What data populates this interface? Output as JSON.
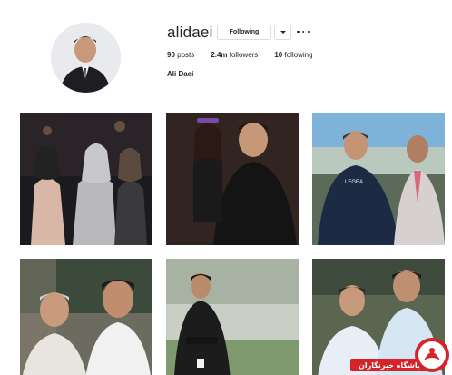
{
  "profile": {
    "username": "alidaei",
    "follow_label": "Following",
    "full_name": "Ali Daei",
    "stats": {
      "posts_count": "90",
      "posts_label": "posts",
      "followers_count": "2.4m",
      "followers_label": "followers",
      "following_count": "10",
      "following_label": "following"
    }
  },
  "icons": {
    "dropdown": "chevron-down-icon",
    "more": "more-options-icon"
  },
  "posts": [
    {
      "description_name": "three women in hijab"
    },
    {
      "description_name": "man holding little girl"
    },
    {
      "description_name": "two men outdoors"
    },
    {
      "description_name": "two men smiling"
    },
    {
      "description_name": "coach on sideline"
    },
    {
      "description_name": "two men posing"
    }
  ],
  "watermark": {
    "text": "باشگاه خبرنگاران",
    "accent": "#d4242a"
  },
  "colors": {
    "border": "#dbdbdb",
    "text": "#262626",
    "background": "#ffffff"
  }
}
